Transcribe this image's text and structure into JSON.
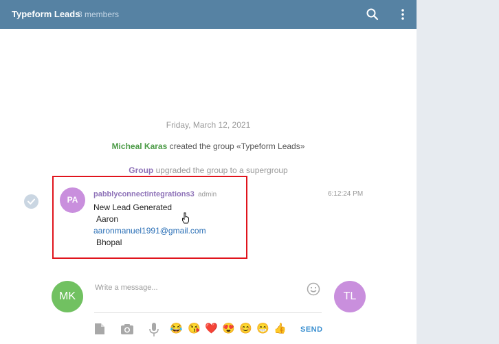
{
  "header": {
    "title": "Typeform Leads",
    "members": "3 members",
    "icons": [
      "search-icon",
      "more-vertical-icon"
    ]
  },
  "chat": {
    "date": "Friday, March 12, 2021",
    "service1": {
      "actor": "Micheal Karas",
      "text": " created the group «Typeform Leads»"
    },
    "service2": {
      "actor": "Group",
      "text": " upgraded the group to a supergroup"
    },
    "message": {
      "avatar": "PA",
      "sender": "pabblyconnectintegrations3",
      "role": "admin",
      "time": "6:12:24 PM",
      "lines": [
        "New Lead Generated",
        "Aaron",
        "aaronmanuel1991@gmail.com",
        "Bhopal"
      ]
    }
  },
  "composer": {
    "my_avatar": "MK",
    "peer_avatar": "TL",
    "placeholder": "Write a message...",
    "send_label": "SEND",
    "emojis": [
      "😂",
      "😘",
      "❤️",
      "😍",
      "😊",
      "😁",
      "👍"
    ]
  },
  "colors": {
    "header": "#5682a3",
    "accent": "#3a8fd0",
    "highlight_border": "#e0141d",
    "avatar_pa": "#c98fdd",
    "avatar_mk": "#71c161",
    "avatar_tl": "#c98fdd"
  }
}
